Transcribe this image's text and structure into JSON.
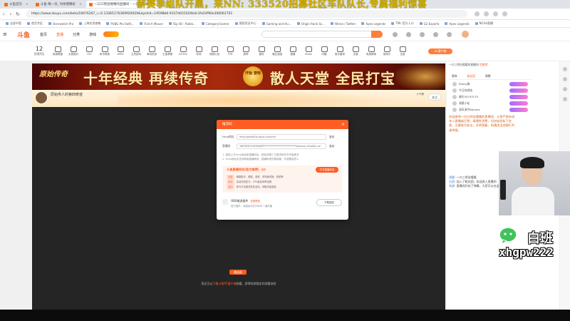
{
  "browser": {
    "tabs": [
      {
        "label": "斗鱼首页",
        "active": false
      },
      {
        "label": "斗鱼·每一天, 为你而精彩",
        "active": false
      },
      {
        "label": "一口三明治嘻嘻的直播间 - 一口三明治",
        "active": true
      }
    ],
    "url": "https://www.douyu.com/beta/16676267_r=0.13365176369920029&dyshid=19598b6-9337d031020b4c1fa54f90e300061701",
    "bookmarks": [
      "全部书签",
      "首页专区",
      "Overwatch Pro",
      "上海实用攻略",
      "PUBG Pro Setti...",
      "Find A Mouse",
      "Top 40 - Roblo...",
      "Category:Gamer",
      "图形验证中心",
      "Gaming and Hu...",
      "Origin Rank Sc...",
      "Wrara / Twitter",
      "Apex Legends",
      "TMc 官方入口",
      "G2 Esports",
      "Apex Legends",
      "NCAA直播"
    ]
  },
  "overlay_banner": "薪赛季组队开黑，来NN: 333520招募社区车队队长,专属福利惊喜",
  "site": {
    "logo": "斗鱼",
    "nav": [
      "首页",
      "直播",
      "分类",
      "游戏"
    ],
    "active_nav": "直播"
  },
  "categories": {
    "date": "12",
    "date_label": "直播预告",
    "items": [
      "英雄联盟",
      "无畏契约",
      "CS2",
      "和平精英",
      "APEX",
      "主机游戏",
      "单机热游",
      "王者荣耀",
      "DOTA2",
      "吃鸡",
      "穿越火线",
      "户外",
      "原神",
      "星际",
      "暗区突围",
      "魔兽",
      "Blues",
      "闪耀",
      "鱼乐星球",
      "文娱",
      "电竞赛事",
      "放映厅",
      "全部"
    ],
    "cta": "PC客户端"
  },
  "banner": {
    "left": "原始传奇",
    "main": "十年经典 再续传奇",
    "badge": "开始 游戏",
    "right": "散人天堂 全民打宝"
  },
  "room": {
    "title": "原始传人的第四奇迹",
    "follow": "关注",
    "rank": "人气榜"
  },
  "player": {
    "play_button": "播放器",
    "notice_pre": "您还可以",
    "notice_link": "下载斗鱼PC客户端",
    "notice_post": "观看，获得纯净稳定的观看体验"
  },
  "modal": {
    "title": "推流码",
    "close": "×",
    "rtmp_label": "rtmp地址",
    "rtmp_value": "rtmp://sendtc3a.douyu.com/live",
    "key_label": "直播码",
    "key_value": "16676267rHHYDKHIPY***************************&dsuma=rtmp&tl=ne",
    "copy": "复制",
    "tips": [
      "1. 复制上方rtmp地址和直播码后，粘贴到第三方推流软件中开始推流",
      "2. rtmp地址仅支持原画直播使用，直播码请妥善保管，勿泄露给他人"
    ],
    "tool": {
      "title": "斗鱼直播伴侣(官方推荐)",
      "badge": "推荐",
      "button": "打开直播伴侣",
      "lines": [
        {
          "tag": "功能",
          "text": "弹幕助手、美颜、音效、多场景切换、特效等"
        },
        {
          "tag": "优化",
          "text": "自动识别显卡、CPU最佳码率设置"
        },
        {
          "tag": "活动",
          "text": "参与平台推流任务活动，领取流量奖励"
        }
      ]
    },
    "plugin": {
      "title": "OBS推流插件",
      "link": "查看教程",
      "desc": "官方插件，安装后可在OBS中一键开播",
      "button": "下载插件"
    }
  },
  "sidebar": {
    "top_text": "一口三明治嘻嘻的直播间",
    "hot": "贡献榜",
    "tabs": [
      "贵宾",
      "粉丝团",
      "周榜"
    ],
    "active_tab": "粉丝团",
    "fans": [
      "Reoxy森",
      "今日的烦恼",
      "佛尔50193279",
      "清晨小仙",
      "清风清竹Banana"
    ],
    "announcement": "欢迎来到一口三明治嘻嘻的直播间，斗鱼严禁未成年人直播或打赏，请理性消费，切勿轻信私下交易，注意账号安全，文明观看，如遇违法违规行为请举报。",
    "chat": [
      {
        "name": "游客",
        "text": "一口三明治嘻嘻"
      },
      {
        "name": "白班",
        "text": "加入了粉丝团，欢迎进入直播间"
      },
      {
        "name": "系统",
        "text": "直播间开启了弹幕，大家可以在这里聊天"
      }
    ]
  },
  "wechat": {
    "name": "白班",
    "id": "xhgpw222"
  }
}
